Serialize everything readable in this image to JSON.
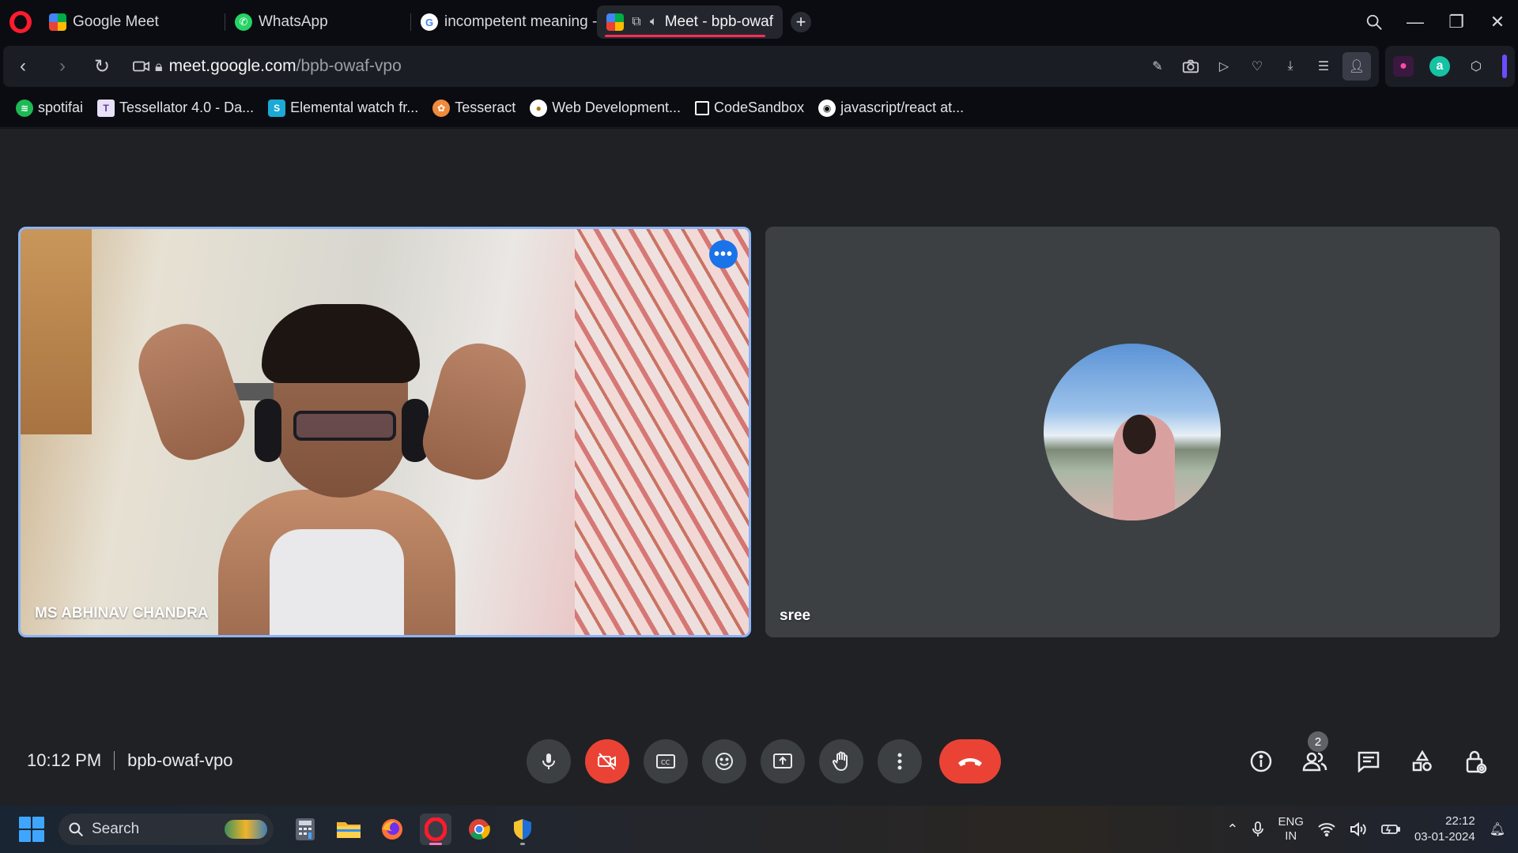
{
  "browser": {
    "tabs": [
      {
        "label": "Google Meet",
        "favicon": "google-meet-icon"
      },
      {
        "label": "WhatsApp",
        "favicon": "whatsapp-icon"
      },
      {
        "label": "incompetent meaning -",
        "favicon": "google-icon"
      },
      {
        "label": "Meet - bpb-owaf",
        "favicon": "google-meet-icon",
        "active": true
      }
    ],
    "url_host": "meet.google.com",
    "url_path": "/bpb-owaf-vpo",
    "bookmarks": [
      {
        "label": "spotifai",
        "color": "#1db954"
      },
      {
        "label": "Tessellator 4.0 - Da...",
        "color": "#6b4fbb"
      },
      {
        "label": "Elemental watch fr...",
        "color": "#1ba9d6"
      },
      {
        "label": "Tesseract",
        "color": "#f08a3c"
      },
      {
        "label": "Web Development...",
        "color": "#f5c518"
      },
      {
        "label": "CodeSandbox",
        "color": "#ffffff"
      },
      {
        "label": "javascript/react at...",
        "color": "#ffffff"
      }
    ]
  },
  "meet": {
    "tiles": {
      "local_name": "MS ABHINAV CHANDRA",
      "remote_name": "sree",
      "menu_glyph": "•••"
    },
    "time": "10:12 PM",
    "meeting_code": "bpb-owaf-vpo",
    "participant_count": "2",
    "colors": {
      "accent": "#8ab4f8",
      "danger": "#ea4335",
      "control_bg": "#3c4043"
    }
  },
  "taskbar": {
    "search_placeholder": "Search",
    "lang_top": "ENG",
    "lang_bottom": "IN",
    "time": "22:12",
    "date": "03-01-2024"
  }
}
